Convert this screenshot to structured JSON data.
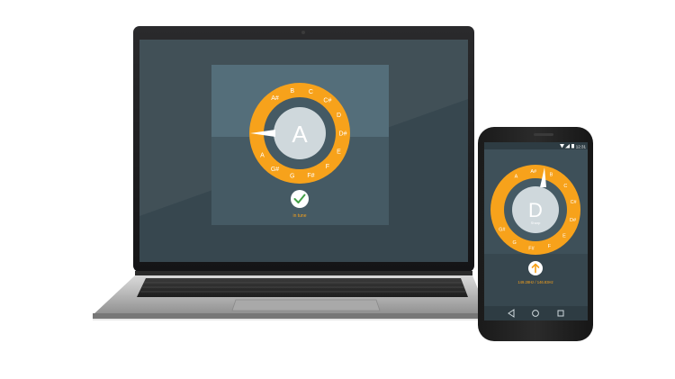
{
  "laptop": {
    "tuner": {
      "note": "A",
      "ring_letters": [
        "A#",
        "B",
        "C",
        "C#",
        "D",
        "D#",
        "E",
        "F",
        "F#",
        "G",
        "G#",
        "A"
      ],
      "status": "in tune",
      "status_icon": "check-icon"
    }
  },
  "phone": {
    "status_bar": {
      "time": "12:31"
    },
    "tuner": {
      "note": "D",
      "subtitle": "Sharp",
      "ring_letters": [
        "A",
        "A#",
        "B",
        "C",
        "C#",
        "D#",
        "E",
        "F",
        "F#",
        "G",
        "G#"
      ],
      "frequency_text": "149.28Hz / 146.83Hz",
      "direction_icon": "arrow-up-icon"
    },
    "nav": {
      "back_icon": "back-triangle-icon",
      "home_icon": "home-circle-icon",
      "recents_icon": "recents-square-icon"
    }
  },
  "colors": {
    "orange": "#F7A21B",
    "dark_panel": "#37474F",
    "mid_panel": "#546E7A",
    "light_panel": "#5E737D",
    "center_disc": "#CFD8DC",
    "green": "#43A047"
  }
}
